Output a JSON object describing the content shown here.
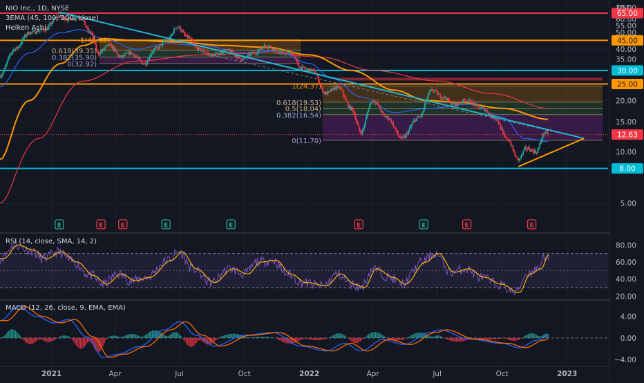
{
  "header": {
    "symbol": "NIO Inc., 1D, NYSE",
    "ema_label": "3EMA (45, 100, 200, close)",
    "candle_type": "Heiken Ashi"
  },
  "price_axis": {
    "currency": "USD",
    "ticks": [
      "70.00",
      "65.00",
      "60.00",
      "55.00",
      "50.00",
      "45.00",
      "40.00",
      "35.00",
      "30.00",
      "25.00",
      "20.00",
      "15.00",
      "10.00",
      "5.00"
    ],
    "range": [
      4,
      72
    ],
    "horizontal_levels": [
      {
        "label": "65.00",
        "value": 65,
        "color": "#f23645"
      },
      {
        "label": "45.00",
        "value": 45,
        "color": "#ff9800"
      },
      {
        "label": "30.00",
        "value": 30,
        "color": "#00bcd4"
      },
      {
        "label": "25.00",
        "value": 25,
        "color": "#ff9800"
      },
      {
        "label": "8.00",
        "value": 8,
        "color": "#00bcd4"
      }
    ],
    "current_price": {
      "label": "12.63",
      "value": 12.63,
      "color": "#f23645"
    }
  },
  "fib_set_1": {
    "levels": [
      {
        "label": "1(45.33)",
        "value": 45.33
      },
      {
        "label": "0.618(39.35)",
        "value": 39.35
      },
      {
        "label": "0.382(35.90)",
        "value": 35.9
      },
      {
        "label": "0(32.92)",
        "value": 32.92
      }
    ]
  },
  "fib_set_2": {
    "levels": [
      {
        "label": "1(24.37)",
        "value": 24.37
      },
      {
        "label": "0.618(19.53)",
        "value": 19.53
      },
      {
        "label": "0.5(18.04)",
        "value": 18.04
      },
      {
        "label": "0.382(16.54)",
        "value": 16.54
      },
      {
        "label": "0(11.70)",
        "value": 11.7
      }
    ]
  },
  "earnings_markers": [
    {
      "label": "E",
      "color": "#26a69a",
      "date": "2021-01"
    },
    {
      "label": "E",
      "color": "#f23645",
      "date": "2021-03"
    },
    {
      "label": "E",
      "color": "#f23645",
      "date": "2021-04"
    },
    {
      "label": "E",
      "color": "#26a69a",
      "date": "2021-06"
    },
    {
      "label": "E",
      "color": "#26a69a",
      "date": "2021-09"
    },
    {
      "label": "E",
      "color": "#f23645",
      "date": "2022-03"
    },
    {
      "label": "E",
      "color": "#26a69a",
      "date": "2022-06"
    },
    {
      "label": "E",
      "color": "#f23645",
      "date": "2022-08"
    },
    {
      "label": "E",
      "color": "#f23645",
      "date": "2022-11"
    }
  ],
  "rsi_panel": {
    "label": "RSI (14, close, SMA, 14, 2)",
    "ticks": [
      "80.00",
      "60.00",
      "40.00",
      "20.00"
    ],
    "range": [
      17,
      90
    ],
    "band": [
      30,
      70
    ]
  },
  "macd_panel": {
    "label": "MACD (12, 26, close, 9, EMA, EMA)",
    "ticks": [
      "4.00",
      "0.00",
      "−4.00"
    ],
    "range": [
      -5,
      6.5
    ]
  },
  "time_axis": {
    "labels": [
      {
        "label": "2021",
        "date": "2021-01",
        "bold": true
      },
      {
        "label": "Apr",
        "date": "2021-04",
        "bold": false
      },
      {
        "label": "Jul",
        "date": "2021-07",
        "bold": false
      },
      {
        "label": "Oct",
        "date": "2021-10",
        "bold": false
      },
      {
        "label": "2022",
        "date": "2022-01",
        "bold": true
      },
      {
        "label": "Apr",
        "date": "2022-04",
        "bold": false
      },
      {
        "label": "Jul",
        "date": "2022-07",
        "bold": false
      },
      {
        "label": "Oct",
        "date": "2022-10",
        "bold": false
      },
      {
        "label": "2023",
        "date": "2023-01",
        "bold": true
      }
    ]
  },
  "colors": {
    "background": "#131722",
    "up": "#26a69a",
    "down": "#f23645",
    "trendline": "#22b5cf",
    "ema45": "#2962ff",
    "ema100": "#ff9800",
    "ema200": "#f23645",
    "rsi": "#7e57c2",
    "rsi_ma": "#ffb300",
    "macd": "#2962ff",
    "signal": "#ff6d00"
  },
  "chart_data": {
    "type": "candlestick",
    "title": "NIO Inc., 1D, NYSE",
    "ylabel": "USD",
    "y_scale": "log",
    "ylim": [
      4,
      72
    ],
    "x_range": [
      "2020-10-20",
      "2023-02-28"
    ],
    "grid": true,
    "price_anchors": [
      {
        "date": "2020-10-20",
        "close": 28
      },
      {
        "date": "2020-11-10",
        "close": 40
      },
      {
        "date": "2020-12-01",
        "close": 50
      },
      {
        "date": "2020-12-22",
        "close": 52
      },
      {
        "date": "2021-01-11",
        "close": 62
      },
      {
        "date": "2021-01-25",
        "close": 60
      },
      {
        "date": "2021-02-09",
        "close": 62
      },
      {
        "date": "2021-02-25",
        "close": 50
      },
      {
        "date": "2021-03-08",
        "close": 38
      },
      {
        "date": "2021-03-24",
        "close": 42
      },
      {
        "date": "2021-04-09",
        "close": 36
      },
      {
        "date": "2021-04-22",
        "close": 38
      },
      {
        "date": "2021-05-12",
        "close": 33
      },
      {
        "date": "2021-05-28",
        "close": 40
      },
      {
        "date": "2021-06-14",
        "close": 45
      },
      {
        "date": "2021-06-28",
        "close": 54
      },
      {
        "date": "2021-07-12",
        "close": 47
      },
      {
        "date": "2021-07-28",
        "close": 40
      },
      {
        "date": "2021-08-16",
        "close": 37
      },
      {
        "date": "2021-09-08",
        "close": 39
      },
      {
        "date": "2021-09-28",
        "close": 35
      },
      {
        "date": "2021-10-15",
        "close": 38
      },
      {
        "date": "2021-11-01",
        "close": 42
      },
      {
        "date": "2021-11-22",
        "close": 38
      },
      {
        "date": "2021-12-06",
        "close": 38
      },
      {
        "date": "2021-12-20",
        "close": 31
      },
      {
        "date": "2022-01-05",
        "close": 30
      },
      {
        "date": "2022-01-24",
        "close": 22
      },
      {
        "date": "2022-02-10",
        "close": 24
      },
      {
        "date": "2022-03-01",
        "close": 18
      },
      {
        "date": "2022-03-15",
        "close": 13
      },
      {
        "date": "2022-04-01",
        "close": 20
      },
      {
        "date": "2022-04-20",
        "close": 16
      },
      {
        "date": "2022-05-12",
        "close": 12
      },
      {
        "date": "2022-06-06",
        "close": 16
      },
      {
        "date": "2022-06-24",
        "close": 23
      },
      {
        "date": "2022-07-08",
        "close": 21
      },
      {
        "date": "2022-07-25",
        "close": 19
      },
      {
        "date": "2022-08-12",
        "close": 20
      },
      {
        "date": "2022-09-02",
        "close": 18
      },
      {
        "date": "2022-09-20",
        "close": 16
      },
      {
        "date": "2022-10-07",
        "close": 12
      },
      {
        "date": "2022-10-24",
        "close": 9
      },
      {
        "date": "2022-11-04",
        "close": 10.5
      },
      {
        "date": "2022-11-18",
        "close": 10
      },
      {
        "date": "2022-12-01",
        "close": 13
      },
      {
        "date": "2022-12-06",
        "close": 12.63
      }
    ],
    "ema45_anchors": [
      {
        "date": "2020-10-20",
        "value": 24
      },
      {
        "date": "2020-12-01",
        "value": 38
      },
      {
        "date": "2021-01-15",
        "value": 50
      },
      {
        "date": "2021-02-10",
        "value": 52
      },
      {
        "date": "2021-03-15",
        "value": 46
      },
      {
        "date": "2021-05-01",
        "value": 40
      },
      {
        "date": "2021-06-15",
        "value": 43
      },
      {
        "date": "2021-08-01",
        "value": 42
      },
      {
        "date": "2021-10-01",
        "value": 38
      },
      {
        "date": "2021-11-15",
        "value": 39
      },
      {
        "date": "2022-01-01",
        "value": 33
      },
      {
        "date": "2022-02-01",
        "value": 27
      },
      {
        "date": "2022-03-15",
        "value": 21
      },
      {
        "date": "2022-05-01",
        "value": 17
      },
      {
        "date": "2022-06-20",
        "value": 18
      },
      {
        "date": "2022-08-15",
        "value": 19
      },
      {
        "date": "2022-10-01",
        "value": 16
      },
      {
        "date": "2022-11-01",
        "value": 12
      },
      {
        "date": "2022-12-06",
        "value": 11.5
      }
    ],
    "ema100_anchors": [
      {
        "date": "2020-10-20",
        "value": 9
      },
      {
        "date": "2020-12-01",
        "value": 20
      },
      {
        "date": "2021-01-15",
        "value": 33
      },
      {
        "date": "2021-02-15",
        "value": 42
      },
      {
        "date": "2021-03-15",
        "value": 46
      },
      {
        "date": "2021-05-01",
        "value": 45
      },
      {
        "date": "2021-07-01",
        "value": 44
      },
      {
        "date": "2021-09-01",
        "value": 42
      },
      {
        "date": "2021-11-01",
        "value": 41
      },
      {
        "date": "2022-01-01",
        "value": 37
      },
      {
        "date": "2022-03-01",
        "value": 30
      },
      {
        "date": "2022-05-01",
        "value": 23
      },
      {
        "date": "2022-06-15",
        "value": 20
      },
      {
        "date": "2022-08-01",
        "value": 19.5
      },
      {
        "date": "2022-10-01",
        "value": 18
      },
      {
        "date": "2022-12-06",
        "value": 15.5
      }
    ],
    "ema200_anchors": [
      {
        "date": "2020-10-20",
        "value": 5
      },
      {
        "date": "2020-12-15",
        "value": 12
      },
      {
        "date": "2021-02-15",
        "value": 26
      },
      {
        "date": "2021-05-01",
        "value": 34
      },
      {
        "date": "2021-08-01",
        "value": 37
      },
      {
        "date": "2021-11-01",
        "value": 38
      },
      {
        "date": "2022-01-15",
        "value": 36
      },
      {
        "date": "2022-04-01",
        "value": 30
      },
      {
        "date": "2022-07-01",
        "value": 26
      },
      {
        "date": "2022-09-15",
        "value": 22
      },
      {
        "date": "2022-12-06",
        "value": 18
      }
    ],
    "trendlines": [
      {
        "name": "descending-resistance",
        "from": {
          "date": "2021-01-11",
          "price": 66
        },
        "to": {
          "date": "2023-01-25",
          "price": 12
        }
      },
      {
        "name": "rising-support",
        "from": {
          "date": "2022-10-24",
          "price": 8.2
        },
        "to": {
          "date": "2023-01-25",
          "price": 12
        }
      }
    ],
    "rsi_anchors": [
      {
        "date": "2020-10-20",
        "value": 64
      },
      {
        "date": "2020-11-10",
        "value": 80
      },
      {
        "date": "2020-12-01",
        "value": 74
      },
      {
        "date": "2020-12-20",
        "value": 64
      },
      {
        "date": "2021-01-10",
        "value": 72
      },
      {
        "date": "2021-02-01",
        "value": 60
      },
      {
        "date": "2021-02-25",
        "value": 44
      },
      {
        "date": "2021-03-15",
        "value": 34
      },
      {
        "date": "2021-04-05",
        "value": 46
      },
      {
        "date": "2021-04-25",
        "value": 38
      },
      {
        "date": "2021-05-15",
        "value": 42
      },
      {
        "date": "2021-06-15",
        "value": 62
      },
      {
        "date": "2021-06-30",
        "value": 72
      },
      {
        "date": "2021-07-20",
        "value": 52
      },
      {
        "date": "2021-08-15",
        "value": 36
      },
      {
        "date": "2021-09-10",
        "value": 52
      },
      {
        "date": "2021-10-01",
        "value": 46
      },
      {
        "date": "2021-10-20",
        "value": 60
      },
      {
        "date": "2021-11-10",
        "value": 62
      },
      {
        "date": "2021-12-01",
        "value": 46
      },
      {
        "date": "2021-12-22",
        "value": 36
      },
      {
        "date": "2022-01-20",
        "value": 32
      },
      {
        "date": "2022-02-10",
        "value": 46
      },
      {
        "date": "2022-03-01",
        "value": 34
      },
      {
        "date": "2022-03-15",
        "value": 30
      },
      {
        "date": "2022-04-01",
        "value": 52
      },
      {
        "date": "2022-04-25",
        "value": 42
      },
      {
        "date": "2022-05-12",
        "value": 34
      },
      {
        "date": "2022-06-10",
        "value": 60
      },
      {
        "date": "2022-06-28",
        "value": 70
      },
      {
        "date": "2022-07-20",
        "value": 48
      },
      {
        "date": "2022-08-10",
        "value": 52
      },
      {
        "date": "2022-09-01",
        "value": 42
      },
      {
        "date": "2022-09-25",
        "value": 34
      },
      {
        "date": "2022-10-20",
        "value": 24
      },
      {
        "date": "2022-11-05",
        "value": 46
      },
      {
        "date": "2022-11-20",
        "value": 52
      },
      {
        "date": "2022-12-01",
        "value": 68
      },
      {
        "date": "2022-12-06",
        "value": 62
      }
    ],
    "macd_anchors": [
      {
        "date": "2020-10-20",
        "value": 3.2
      },
      {
        "date": "2020-11-15",
        "value": 5.8
      },
      {
        "date": "2020-12-10",
        "value": 4.0
      },
      {
        "date": "2021-01-05",
        "value": 2.8
      },
      {
        "date": "2021-01-25",
        "value": 3.4
      },
      {
        "date": "2021-02-20",
        "value": 0.2
      },
      {
        "date": "2021-03-15",
        "value": -3.6
      },
      {
        "date": "2021-04-05",
        "value": -3.0
      },
      {
        "date": "2021-05-05",
        "value": -1.6
      },
      {
        "date": "2021-06-10",
        "value": 1.5
      },
      {
        "date": "2021-07-01",
        "value": 3.0
      },
      {
        "date": "2021-07-25",
        "value": 0.5
      },
      {
        "date": "2021-08-20",
        "value": -1.5
      },
      {
        "date": "2021-10-01",
        "value": 0.5
      },
      {
        "date": "2021-11-10",
        "value": 1.0
      },
      {
        "date": "2021-12-20",
        "value": -1.5
      },
      {
        "date": "2022-01-25",
        "value": -2.4
      },
      {
        "date": "2022-02-20",
        "value": -1.0
      },
      {
        "date": "2022-03-15",
        "value": -2.4
      },
      {
        "date": "2022-04-15",
        "value": -0.3
      },
      {
        "date": "2022-05-15",
        "value": -1.2
      },
      {
        "date": "2022-06-20",
        "value": 1.0
      },
      {
        "date": "2022-07-05",
        "value": 1.5
      },
      {
        "date": "2022-08-15",
        "value": -0.2
      },
      {
        "date": "2022-10-01",
        "value": -1.0
      },
      {
        "date": "2022-10-25",
        "value": -1.8
      },
      {
        "date": "2022-11-20",
        "value": -0.4
      },
      {
        "date": "2022-12-06",
        "value": 0.5
      }
    ]
  }
}
